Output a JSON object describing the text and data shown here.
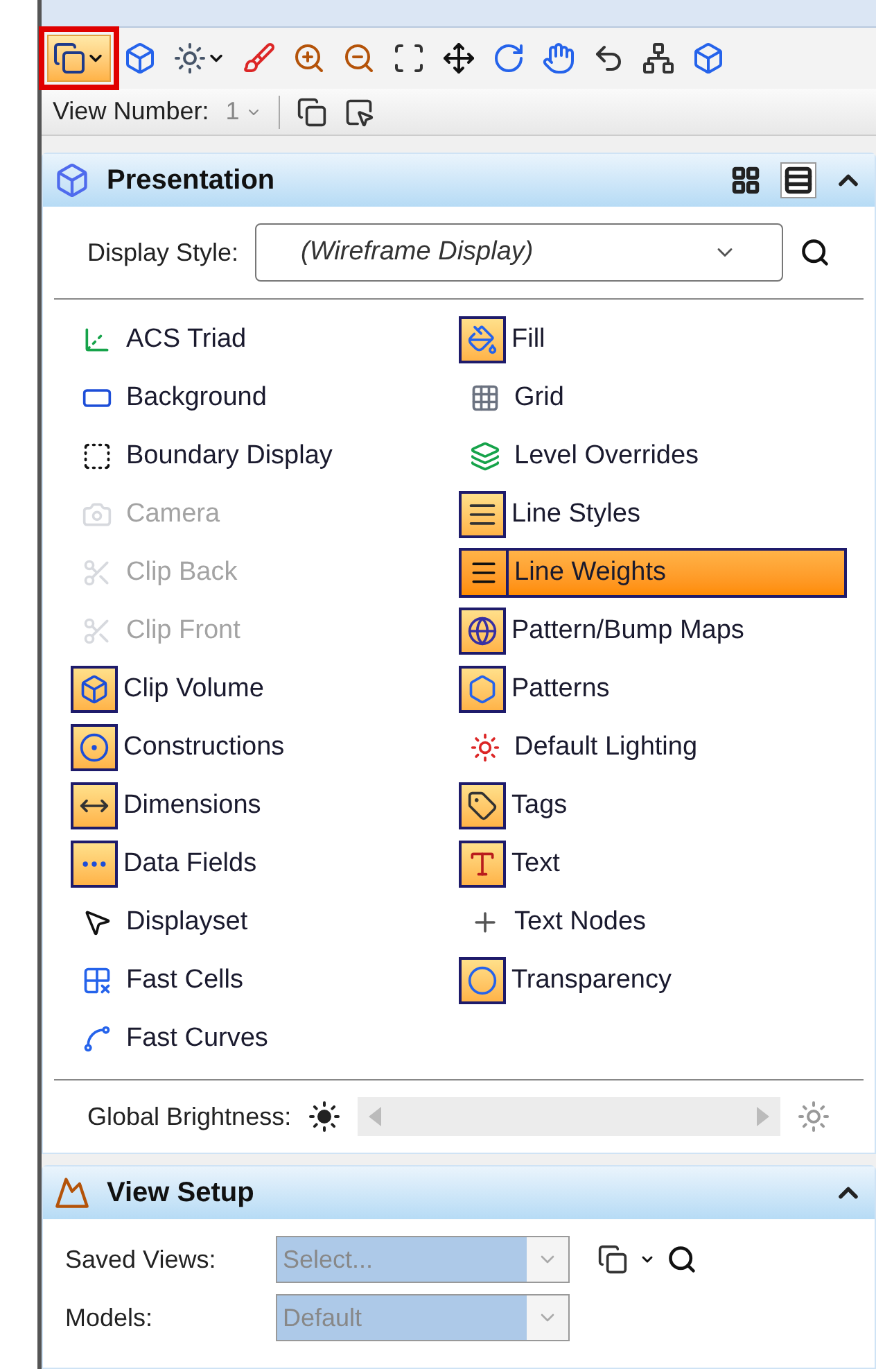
{
  "toolbar": {
    "buttons": [
      {
        "selected": true,
        "annotated": true
      },
      {
        "selected": false,
        "annotated": false
      },
      {
        "selected": false,
        "annotated": false
      },
      {
        "selected": false,
        "annotated": false
      },
      {
        "selected": false,
        "annotated": false
      },
      {
        "selected": false,
        "annotated": false
      },
      {
        "selected": false,
        "annotated": false
      },
      {
        "selected": false,
        "annotated": false
      },
      {
        "selected": false,
        "annotated": false
      },
      {
        "selected": false,
        "annotated": false
      },
      {
        "selected": false,
        "annotated": false
      },
      {
        "selected": false,
        "annotated": false
      },
      {
        "selected": false,
        "annotated": false
      }
    ]
  },
  "view_number": {
    "label": "View Number:",
    "value": "1"
  },
  "presentation": {
    "title": "Presentation",
    "layout_buttons": [
      {
        "selected": false
      },
      {
        "selected": true
      }
    ],
    "display_style": {
      "label": "Display Style:",
      "value": "(Wireframe Display)"
    },
    "left_column": [
      {
        "label": "ACS Triad",
        "on": false,
        "disabled": false,
        "selected": false
      },
      {
        "label": "Background",
        "on": false,
        "disabled": false,
        "selected": false
      },
      {
        "label": "Boundary Display",
        "on": false,
        "disabled": false,
        "selected": false
      },
      {
        "label": "Camera",
        "on": false,
        "disabled": true,
        "selected": false
      },
      {
        "label": "Clip Back",
        "on": false,
        "disabled": true,
        "selected": false
      },
      {
        "label": "Clip Front",
        "on": false,
        "disabled": true,
        "selected": false
      },
      {
        "label": "Clip Volume",
        "on": true,
        "disabled": false,
        "selected": false
      },
      {
        "label": "Constructions",
        "on": true,
        "disabled": false,
        "selected": false
      },
      {
        "label": "Dimensions",
        "on": true,
        "disabled": false,
        "selected": false
      },
      {
        "label": "Data Fields",
        "on": true,
        "disabled": false,
        "selected": false
      },
      {
        "label": "Displayset",
        "on": false,
        "disabled": false,
        "selected": false
      },
      {
        "label": "Fast Cells",
        "on": false,
        "disabled": false,
        "selected": false
      },
      {
        "label": "Fast Curves",
        "on": false,
        "disabled": false,
        "selected": false
      }
    ],
    "right_column": [
      {
        "label": "Fill",
        "on": true,
        "disabled": false,
        "selected": false
      },
      {
        "label": "Grid",
        "on": false,
        "disabled": false,
        "selected": false
      },
      {
        "label": "Level Overrides",
        "on": false,
        "disabled": false,
        "selected": false
      },
      {
        "label": "Line Styles",
        "on": true,
        "disabled": false,
        "selected": false
      },
      {
        "label": "Line Weights",
        "on": true,
        "disabled": false,
        "selected": true
      },
      {
        "label": "Pattern/Bump Maps",
        "on": true,
        "disabled": false,
        "selected": false
      },
      {
        "label": "Patterns",
        "on": true,
        "disabled": false,
        "selected": false
      },
      {
        "label": "Default Lighting",
        "on": false,
        "disabled": false,
        "selected": false
      },
      {
        "label": "Tags",
        "on": true,
        "disabled": false,
        "selected": false
      },
      {
        "label": "Text",
        "on": true,
        "disabled": false,
        "selected": false
      },
      {
        "label": "Text Nodes",
        "on": false,
        "disabled": false,
        "selected": false
      },
      {
        "label": "Transparency",
        "on": true,
        "disabled": false,
        "selected": false
      }
    ],
    "global_brightness": {
      "label": "Global Brightness:",
      "disabled": true
    }
  },
  "view_setup": {
    "title": "View Setup",
    "fields": [
      {
        "label": "Saved Views:",
        "placeholder": "Select...",
        "disabled": true
      },
      {
        "label": "Models:",
        "value": "Default",
        "disabled": true
      }
    ]
  }
}
